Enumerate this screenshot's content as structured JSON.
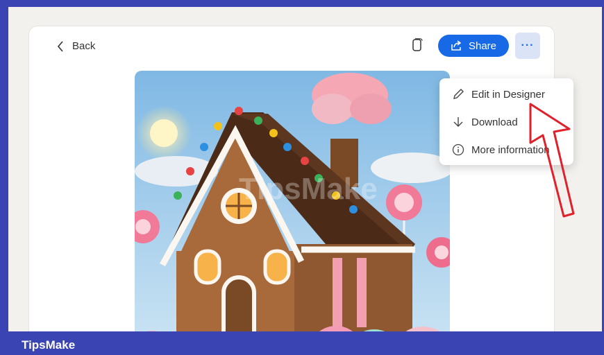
{
  "header": {
    "back_label": "Back",
    "share_label": "Share",
    "more_label": "···"
  },
  "menu": {
    "items": [
      {
        "label": "Edit in Designer",
        "icon": "pencil-icon"
      },
      {
        "label": "Download",
        "icon": "download-icon"
      },
      {
        "label": "More information",
        "icon": "info-icon"
      }
    ]
  },
  "image": {
    "watermark": "TipsMake"
  },
  "footer": {
    "brand": "TipsMake"
  },
  "colors": {
    "accent": "#1769e6",
    "frame": "#3b44b3",
    "annotation": "#e0202a"
  }
}
